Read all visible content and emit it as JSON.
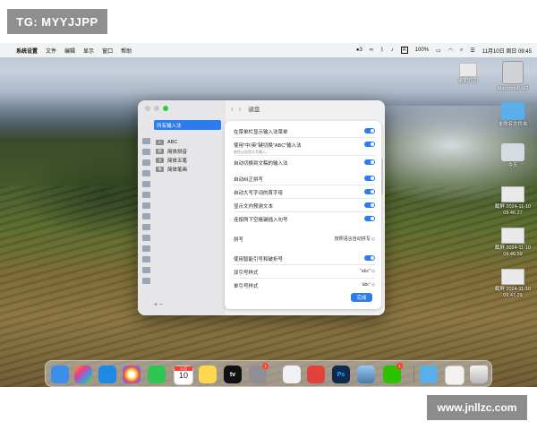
{
  "watermark_top": "TG: MYYJJPP",
  "watermark_bottom": "www.jnllzc.com",
  "menubar": {
    "app": "系统设置",
    "items": [
      "文件",
      "编辑",
      "显示",
      "窗口",
      "帮助"
    ],
    "wechat_count": "3",
    "input_indicator": "A",
    "battery": "100%",
    "datetime": "11月10日 周日 09:45"
  },
  "desktop_icons": [
    {
      "label": "桌面打印"
    },
    {
      "label": "Macintosh HD"
    },
    {
      "label": "未命名文件夹"
    },
    {
      "label": "今天"
    },
    {
      "label": "截屏 2024-11-10 09.46.27"
    },
    {
      "label": "截屏 2024-11-10 09.46.59"
    },
    {
      "label": "截屏 2024-11-10 09.47.29"
    }
  ],
  "window": {
    "toolbar_title": "键盘",
    "sidebar_selected": "所有输入法",
    "input_sources": [
      {
        "badge": "A",
        "label": "ABC"
      },
      {
        "badge": "拼",
        "label": "简体拼音"
      },
      {
        "badge": "五",
        "label": "简体五笔"
      },
      {
        "badge": "笔",
        "label": "简体笔画"
      }
    ],
    "sidebar_buttons": "+  −",
    "settings": [
      {
        "label": "在菜单栏显示输入法菜单",
        "sub": "",
        "on": true
      },
      {
        "label": "使用\"中/英\"键切换\"ABC\"输入法",
        "sub": "按住以启用大写输入。",
        "on": true
      },
      {
        "label": "自动切换到文稿的输入法",
        "sub": "",
        "on": true
      },
      {
        "label": "自动纠正拼写",
        "sub": "",
        "on": true
      },
      {
        "label": "自动大写字词的首字母",
        "sub": "",
        "on": true
      },
      {
        "label": "显示文内预测文本",
        "sub": "",
        "on": true
      },
      {
        "label": "连按两下空格键插入句号",
        "sub": "",
        "on": true
      }
    ],
    "spelling": {
      "label": "拼写",
      "value": "按照语言自动拼写 ◇"
    },
    "smart_quotes": {
      "label": "使用智能引号和破折号",
      "on": true
    },
    "double_quotes": {
      "label": "双引号样式",
      "value": "\"abc\" ◇"
    },
    "single_quotes": {
      "label": "单引号样式",
      "value": "'abc' ◇"
    },
    "done_button": "完成"
  },
  "dock": {
    "calendar_month": "11月",
    "calendar_day": "10",
    "tv_label": "tv",
    "ps_label": "Ps",
    "badges": {
      "settings": "1",
      "wechat": "1"
    }
  },
  "colors": {
    "accent": "#2a7cf0"
  }
}
